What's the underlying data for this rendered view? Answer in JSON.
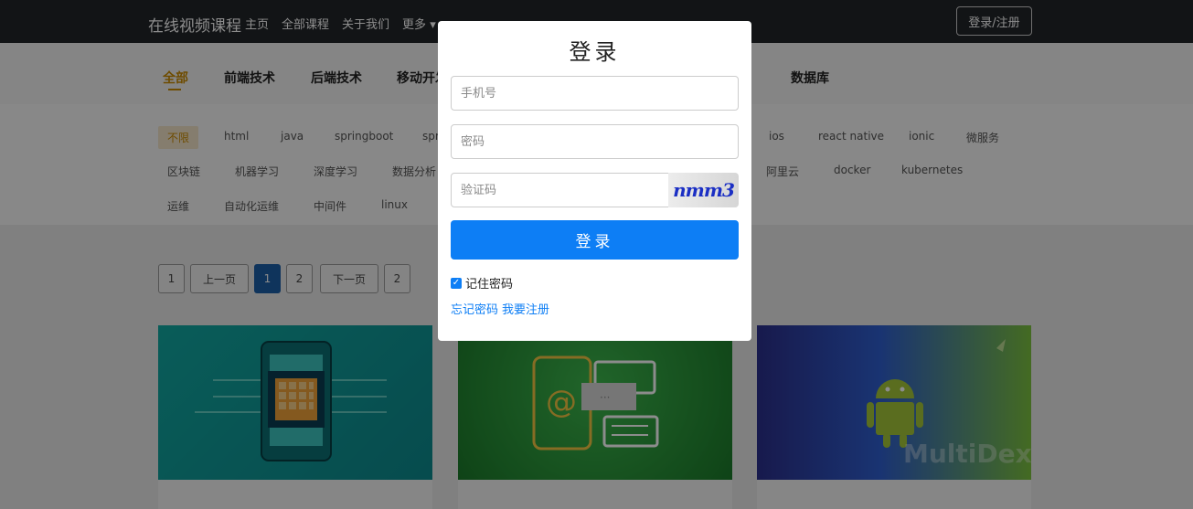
{
  "navbar": {
    "brand": "在线视频课程",
    "links": [
      "主页",
      "全部课程",
      "关于我们",
      "更多"
    ],
    "login_label": "登录/注册"
  },
  "categories": [
    "全部",
    "前端技术",
    "后端技术",
    "移动开发",
    "数据库"
  ],
  "tags": {
    "row1": [
      "不限",
      "html",
      "java",
      "springboot",
      "spr",
      "ios",
      "react native",
      "ionic",
      "微服务"
    ],
    "row2": [
      "区块链",
      "机器学习",
      "深度学习",
      "数据分析",
      "阿里云",
      "docker",
      "kubernetes"
    ],
    "row3": [
      "运维",
      "自动化运维",
      "中间件",
      "linux"
    ]
  },
  "pagination": [
    "1",
    "上一页",
    "1",
    "2",
    "下一页",
    "2"
  ],
  "modal": {
    "title": "登录",
    "phone_placeholder": "手机号",
    "password_placeholder": "密码",
    "captcha_placeholder": "验证码",
    "captcha_text": "nmm3",
    "submit_label": "登录",
    "remember_label": "记住密码",
    "remember_checked": true,
    "forgot_label": "忘记密码",
    "register_label": "我要注册"
  },
  "cards": [
    {
      "image": "chip-phone-illustration"
    },
    {
      "image": "email-chat-illustration"
    },
    {
      "image": "android-multidex-illustration",
      "overlay_text": "MultiDex"
    }
  ],
  "colors": {
    "navbar": "#222529",
    "accent": "#c98a00",
    "primary": "#0d7ef5",
    "pager_active": "#1c5fa8"
  }
}
